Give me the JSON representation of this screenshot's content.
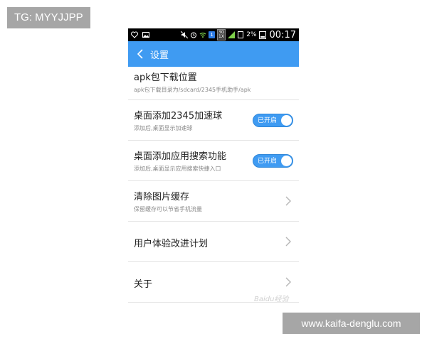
{
  "overlay": {
    "tag": "TG: MYYJJPP",
    "url": "www.kaifa-denglu.com"
  },
  "status_bar": {
    "time": "00:17",
    "battery": "2%",
    "notif_count": "1",
    "network": "3G\n1X"
  },
  "app_bar": {
    "title": "设置"
  },
  "settings": [
    {
      "title": "apk包下载位置",
      "subtitle": "apk包下载目录为/sdcard/2345手机助手/apk"
    },
    {
      "title": "桌面添加2345加速球",
      "subtitle": "添加后,桌面显示加速球",
      "toggle": "已开启"
    },
    {
      "title": "桌面添加应用搜索功能",
      "subtitle": "添加后,桌面显示应用搜索快捷入口",
      "toggle": "已开启"
    },
    {
      "title": "清除图片缓存",
      "subtitle": "保留缓存可以节省手机流量"
    },
    {
      "title": "用户体验改进计划"
    },
    {
      "title": "关于"
    }
  ],
  "watermark": "Baidu经验"
}
